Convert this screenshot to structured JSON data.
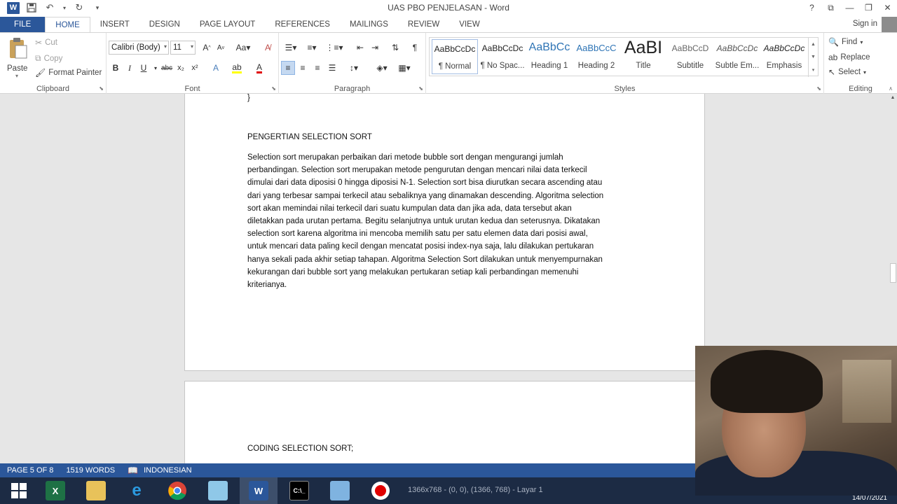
{
  "window": {
    "title": "UAS PBO PENJELASAN - Word",
    "signin": "Sign in"
  },
  "tabs": [
    "FILE",
    "HOME",
    "INSERT",
    "DESIGN",
    "PAGE LAYOUT",
    "REFERENCES",
    "MAILINGS",
    "REVIEW",
    "VIEW"
  ],
  "ribbon": {
    "clipboard": {
      "label": "Clipboard",
      "paste": "Paste",
      "cut": "Cut",
      "copy": "Copy",
      "format_painter": "Format Painter"
    },
    "font": {
      "label": "Font",
      "font_name": "Calibri (Body)",
      "font_size": "11"
    },
    "paragraph": {
      "label": "Paragraph"
    },
    "styles": {
      "label": "Styles",
      "items": [
        {
          "sample": "AaBbCcDc",
          "name": "¶ Normal"
        },
        {
          "sample": "AaBbCcDc",
          "name": "¶ No Spac..."
        },
        {
          "sample": "AaBbCc",
          "name": "Heading 1"
        },
        {
          "sample": "AaBbCcC",
          "name": "Heading 2"
        },
        {
          "sample": "AaBI",
          "name": "Title"
        },
        {
          "sample": "AaBbCcD",
          "name": "Subtitle"
        },
        {
          "sample": "AaBbCcDc",
          "name": "Subtle Em..."
        },
        {
          "sample": "AaBbCcDc",
          "name": "Emphasis"
        }
      ]
    },
    "editing": {
      "label": "Editing",
      "find": "Find",
      "replace": "Replace",
      "select": "Select"
    }
  },
  "document": {
    "brace": "}",
    "heading": "PENGERTIAN SELECTION SORT",
    "lines": [
      "Selection sort merupakan perbaikan dari metode bubble sort dengan mengurangi jumlah",
      "perbandingan. Selection sort merupakan metode pengurutan dengan mencari nilai data terkecil",
      "dimulai dari data diposisi 0 hingga diposisi N-1. Selection sort bisa diurutkan secara ascending atau",
      "dari yang terbesar sampai terkecil atau sebaliknya yang dinamakan descending. Algoritma selection",
      "sort akan memindai nilai terkecil dari suatu kumpulan data dan jika ada, data tersebut akan",
      "diletakkan pada urutan pertama. Begitu selanjutnya untuk urutan kedua dan seterusnya. Dikatakan",
      "selection sort karena algoritma ini mencoba memilih satu per satu elemen data dari posisi awal,",
      "untuk mencari data paling kecil dengan mencatat posisi index-nya saja, lalu dilakukan pertukaran",
      "hanya sekali pada akhir setiap tahapan. Algoritma Selection Sort dilakukan untuk menyempurnakan",
      "kekurangan dari bubble sort yang melakukan pertukaran setiap kali perbandingan memenuhi",
      "kriterianya."
    ],
    "page2_heading": "CODING SELECTION SORT;"
  },
  "statusbar": {
    "page": "PAGE 5 OF 8",
    "words": "1519 WORDS",
    "language": "INDONESIAN"
  },
  "taskbar": {
    "status_text": "1366x768 - (0, 0), (1366, 768) - Layar 1",
    "date": "14/07/2021"
  },
  "colors": {
    "word_blue": "#2b579a",
    "taskbar": "#1c2b44"
  }
}
